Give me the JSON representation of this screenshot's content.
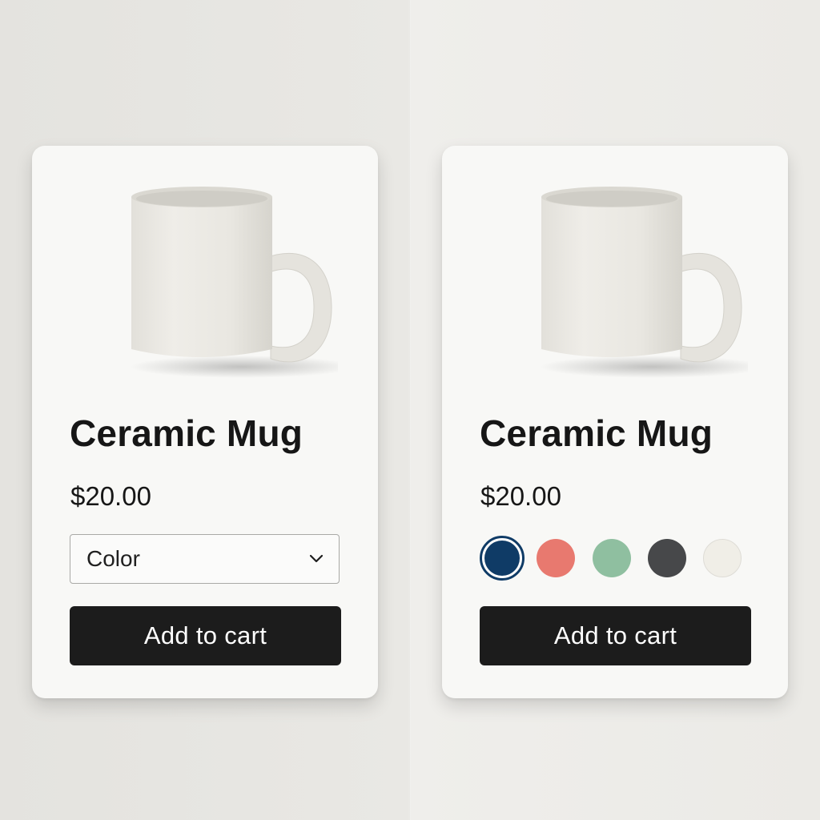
{
  "cards": [
    {
      "variant": "dropdown",
      "product_image": "mug-image",
      "title": "Ceramic Mug",
      "price": "$20.00",
      "color_select": {
        "value": "Color",
        "icon": "chevron-down-icon"
      },
      "button_label": "Add to cart"
    },
    {
      "variant": "swatches",
      "product_image": "mug-image",
      "title": "Ceramic Mug",
      "price": "$20.00",
      "swatches": [
        {
          "color": "#0f3b66",
          "selected": true
        },
        {
          "color": "#e8796f",
          "selected": false
        },
        {
          "color": "#8fbfa0",
          "selected": false
        },
        {
          "color": "#47484a",
          "selected": false
        },
        {
          "color": "#f0eee7",
          "selected": false
        }
      ],
      "button_label": "Add to cart"
    }
  ],
  "colors": {
    "background": "#e9e8e4",
    "card": "#f8f8f6",
    "button": "#1c1c1c",
    "button_text": "#ffffff",
    "text": "#161616"
  }
}
